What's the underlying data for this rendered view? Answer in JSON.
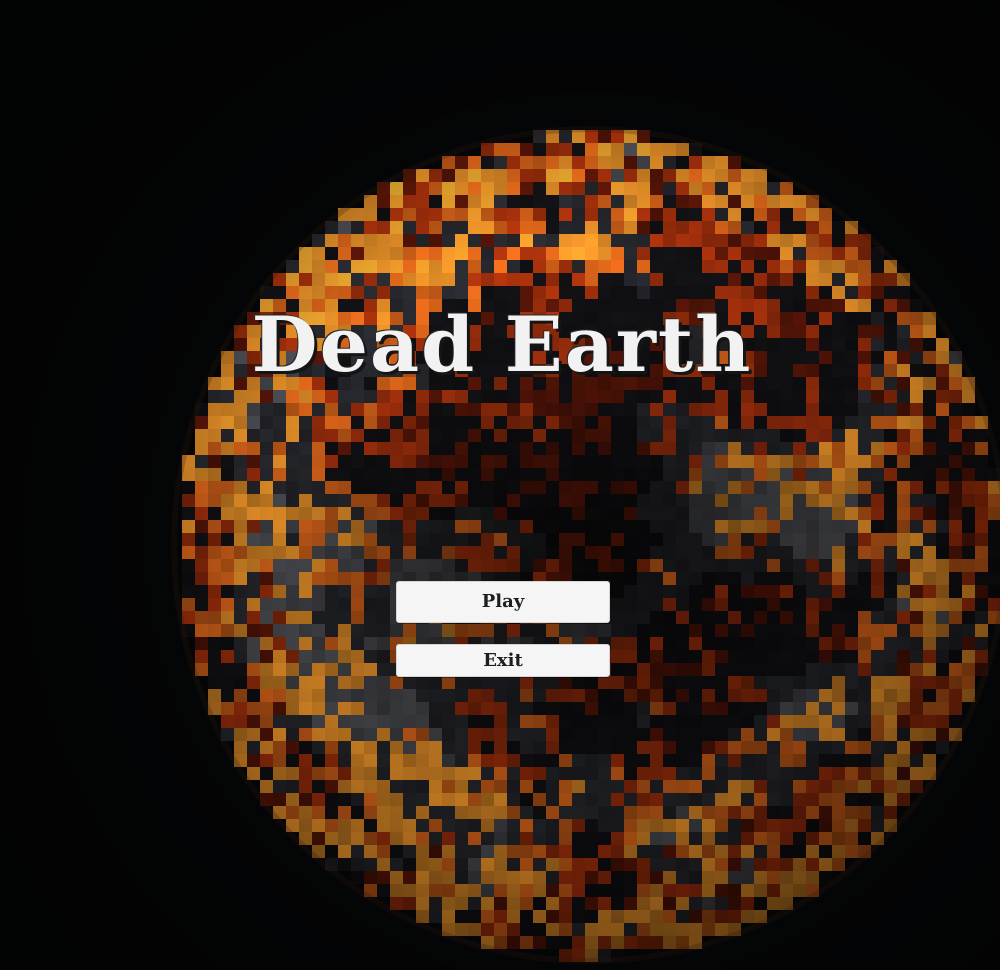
{
  "game": {
    "title": "Dead Earth"
  },
  "menu": {
    "items": [
      {
        "label": "Play"
      },
      {
        "label": "Exit"
      }
    ]
  },
  "background": {
    "planet_style": "pixelated molten dark planet",
    "colors": {
      "space": "#060708",
      "rock_dark": "#141418",
      "rock_mid": "#2c2d33",
      "rock_light": "#55565c",
      "lava_dark": "#5a1608",
      "lava_mid": "#a3300c",
      "lava_bright": "#d9641a",
      "lava_hot": "#f0962a"
    }
  },
  "colors": {
    "title_text": "#f2f2f2",
    "button_bg": "#f5f5f5",
    "button_text": "#1e1e1e"
  }
}
